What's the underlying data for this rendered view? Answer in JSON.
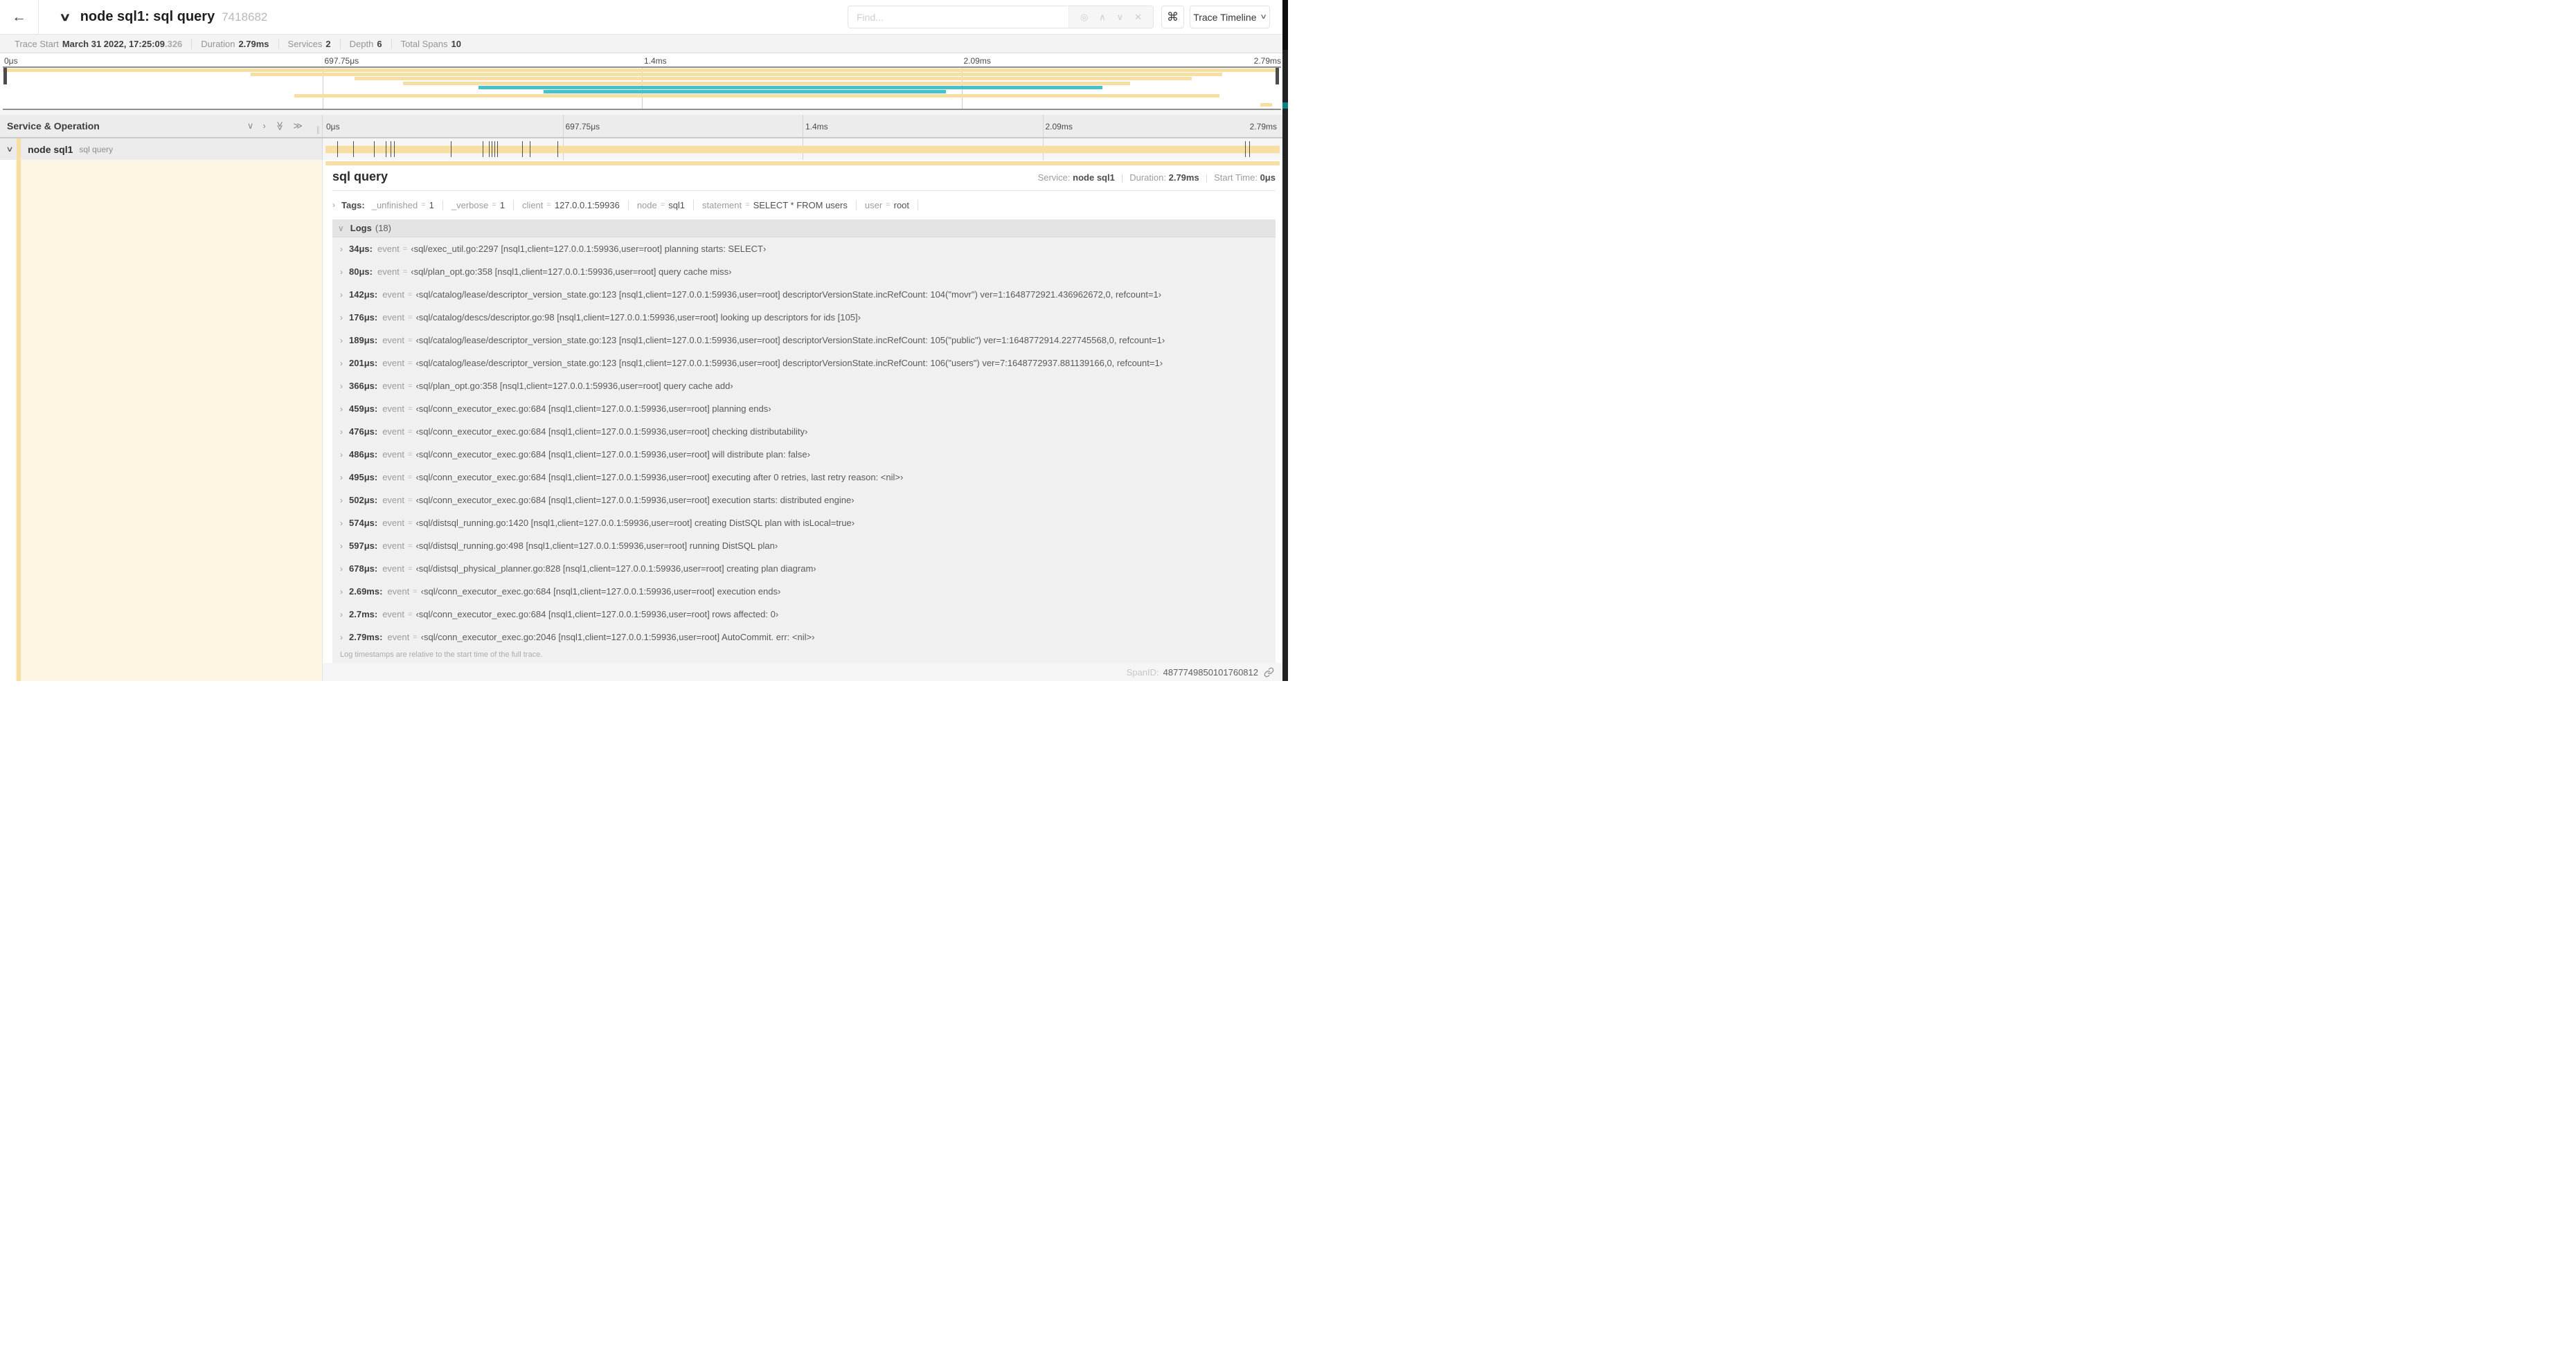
{
  "header": {
    "title": "node sql1: sql query",
    "trace_id": "7418682",
    "find_placeholder": "Find...",
    "view_selector": "Trace Timeline"
  },
  "trace_meta": {
    "items": [
      {
        "label": "Trace Start",
        "value": "March 31 2022, 17:25:09",
        "suffix": ".326"
      },
      {
        "label": "Duration",
        "value": "2.79ms"
      },
      {
        "label": "Services",
        "value": "2"
      },
      {
        "label": "Depth",
        "value": "6"
      },
      {
        "label": "Total Spans",
        "value": "10"
      }
    ]
  },
  "minimap": {
    "ticks": [
      "0μs",
      "697.75μs",
      "1.4ms",
      "2.09ms",
      "2.79ms"
    ],
    "spans": [
      {
        "row": 0,
        "start": 0,
        "end": 99.6,
        "color": "tan"
      },
      {
        "row": 1,
        "start": 19.4,
        "end": 95.4,
        "color": "tan"
      },
      {
        "row": 2,
        "start": 27.5,
        "end": 93.0,
        "color": "tan"
      },
      {
        "row": 3,
        "start": 31.3,
        "end": 88.2,
        "color": "tan"
      },
      {
        "row": 4,
        "start": 37.2,
        "end": 86.0,
        "color": "teal"
      },
      {
        "row": 5,
        "start": 42.3,
        "end": 73.8,
        "color": "teal"
      },
      {
        "row": 6,
        "start": 22.8,
        "end": 95.2,
        "color": "tan"
      },
      {
        "row": 8,
        "start": 98.4,
        "end": 99.3,
        "color": "tan"
      }
    ]
  },
  "timeline": {
    "left_header": "Service & Operation",
    "row": {
      "service": "node sql1",
      "operation": "sql query"
    },
    "log_tick_positions": [
      1.2,
      2.9,
      5.1,
      6.3,
      6.8,
      7.2,
      13.1,
      16.5,
      17.1,
      17.4,
      17.7,
      18.0,
      20.6,
      21.4,
      24.3,
      96.4,
      96.8
    ]
  },
  "detail": {
    "title": "sql query",
    "service_label": "Service:",
    "service": "node sql1",
    "duration_label": "Duration:",
    "duration": "2.79ms",
    "start_label": "Start Time:",
    "start": "0μs",
    "tags_label": "Tags:",
    "tags": [
      {
        "key": "_unfinished",
        "value": "1"
      },
      {
        "key": "_verbose",
        "value": "1"
      },
      {
        "key": "client",
        "value": "127.0.0.1:59936"
      },
      {
        "key": "node",
        "value": "sql1"
      },
      {
        "key": "statement",
        "value": "SELECT * FROM users"
      },
      {
        "key": "user",
        "value": "root"
      }
    ],
    "logs_label": "Logs",
    "logs_count": "(18)",
    "logs": [
      {
        "time": "34μs:",
        "key": "event",
        "value": "‹sql/exec_util.go:2297 [nsql1,client=127.0.0.1:59936,user=root] planning starts: SELECT›"
      },
      {
        "time": "80μs:",
        "key": "event",
        "value": "‹sql/plan_opt.go:358 [nsql1,client=127.0.0.1:59936,user=root] query cache miss›"
      },
      {
        "time": "142μs:",
        "key": "event",
        "value": "‹sql/catalog/lease/descriptor_version_state.go:123 [nsql1,client=127.0.0.1:59936,user=root] descriptorVersionState.incRefCount: 104(\"movr\") ver=1:1648772921.436962672,0, refcount=1›"
      },
      {
        "time": "176μs:",
        "key": "event",
        "value": "‹sql/catalog/descs/descriptor.go:98 [nsql1,client=127.0.0.1:59936,user=root] looking up descriptors for ids [105]›"
      },
      {
        "time": "189μs:",
        "key": "event",
        "value": "‹sql/catalog/lease/descriptor_version_state.go:123 [nsql1,client=127.0.0.1:59936,user=root] descriptorVersionState.incRefCount: 105(\"public\") ver=1:1648772914.227745568,0, refcount=1›"
      },
      {
        "time": "201μs:",
        "key": "event",
        "value": "‹sql/catalog/lease/descriptor_version_state.go:123 [nsql1,client=127.0.0.1:59936,user=root] descriptorVersionState.incRefCount: 106(\"users\") ver=7:1648772937.881139166,0, refcount=1›"
      },
      {
        "time": "366μs:",
        "key": "event",
        "value": "‹sql/plan_opt.go:358 [nsql1,client=127.0.0.1:59936,user=root] query cache add›"
      },
      {
        "time": "459μs:",
        "key": "event",
        "value": "‹sql/conn_executor_exec.go:684 [nsql1,client=127.0.0.1:59936,user=root] planning ends›"
      },
      {
        "time": "476μs:",
        "key": "event",
        "value": "‹sql/conn_executor_exec.go:684 [nsql1,client=127.0.0.1:59936,user=root] checking distributability›"
      },
      {
        "time": "486μs:",
        "key": "event",
        "value": "‹sql/conn_executor_exec.go:684 [nsql1,client=127.0.0.1:59936,user=root] will distribute plan: false›"
      },
      {
        "time": "495μs:",
        "key": "event",
        "value": "‹sql/conn_executor_exec.go:684 [nsql1,client=127.0.0.1:59936,user=root] executing after 0 retries, last retry reason: <nil>›"
      },
      {
        "time": "502μs:",
        "key": "event",
        "value": "‹sql/conn_executor_exec.go:684 [nsql1,client=127.0.0.1:59936,user=root] execution starts: distributed engine›"
      },
      {
        "time": "574μs:",
        "key": "event",
        "value": "‹sql/distsql_running.go:1420 [nsql1,client=127.0.0.1:59936,user=root] creating DistSQL plan with isLocal=true›"
      },
      {
        "time": "597μs:",
        "key": "event",
        "value": "‹sql/distsql_running.go:498 [nsql1,client=127.0.0.1:59936,user=root] running DistSQL plan›"
      },
      {
        "time": "678μs:",
        "key": "event",
        "value": "‹sql/distsql_physical_planner.go:828 [nsql1,client=127.0.0.1:59936,user=root] creating plan diagram›"
      },
      {
        "time": "2.69ms:",
        "key": "event",
        "value": "‹sql/conn_executor_exec.go:684 [nsql1,client=127.0.0.1:59936,user=root] execution ends›"
      },
      {
        "time": "2.7ms:",
        "key": "event",
        "value": "‹sql/conn_executor_exec.go:684 [nsql1,client=127.0.0.1:59936,user=root] rows affected: 0›"
      },
      {
        "time": "2.79ms:",
        "key": "event",
        "value": "‹sql/conn_executor_exec.go:2046 [nsql1,client=127.0.0.1:59936,user=root] AutoCommit. err: <nil>›"
      }
    ],
    "footer_note": "Log timestamps are relative to the start time of the full trace.",
    "spanid_label": "SpanID:",
    "spanid": "4877749850101760812"
  },
  "icons": {
    "back": "←",
    "chevron_down": "∨",
    "chevron_right": "›",
    "double_chevron": "≫",
    "target": "◎",
    "up": "∧",
    "down": "∨",
    "close": "✕",
    "command": "⌘",
    "equals": "=",
    "grip": "∥"
  },
  "colors": {
    "tan": "#f7dfa4",
    "teal": "#46c3c8",
    "cream": "#fdf6e3"
  }
}
